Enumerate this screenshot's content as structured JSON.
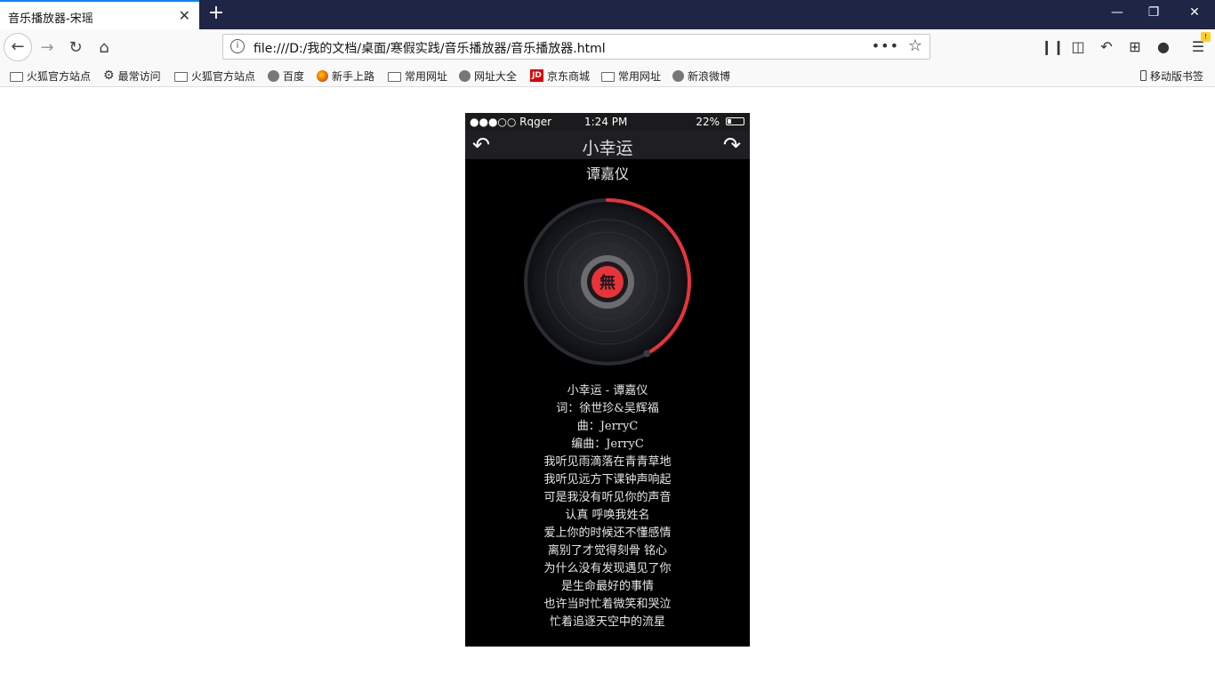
{
  "browser": {
    "tab_title": "音乐播放器-宋瑶",
    "tab_close": "✕",
    "new_tab": "+",
    "url": "file:///D:/我的文档/桌面/寒假实践/音乐播放器/音乐播放器.html",
    "more": "•••",
    "badge": "!"
  },
  "bookmarks": [
    {
      "label": "火狐官方站点",
      "icon": "folder-icon"
    },
    {
      "label": "最常访问",
      "icon": "gear-icon"
    },
    {
      "label": "火狐官方站点",
      "icon": "folder-icon"
    },
    {
      "label": "百度",
      "icon": "globe-icon"
    },
    {
      "label": "新手上路",
      "icon": "firefox-icon"
    },
    {
      "label": "常用网址",
      "icon": "folder-icon"
    },
    {
      "label": "网址大全",
      "icon": "globe-icon"
    },
    {
      "label": "京东商城",
      "icon": "jd-icon"
    },
    {
      "label": "常用网址",
      "icon": "folder-icon"
    },
    {
      "label": "新浪微博",
      "icon": "globe-icon"
    }
  ],
  "mobile_bookmarks": "移动版书签",
  "phone": {
    "carrier": "●●●○○ Rqger",
    "time": "1:24 PM",
    "battery": "22%",
    "battery_level": 0.22,
    "song_title": "小幸运",
    "artist": "谭嘉仪",
    "progress": 0.42,
    "disc_label": "無",
    "accent_color": "#e8333b",
    "lyrics": [
      "小幸运 - 谭嘉仪",
      "词：徐世珍&吴辉福",
      "曲：JerryC",
      "编曲：JerryC",
      "我听见雨滴落在青青草地",
      "我听见远方下课钟声响起",
      "可是我没有听见你的声音",
      "认真 呼唤我姓名",
      "爱上你的时候还不懂感情",
      "离别了才觉得刻骨 铭心",
      "为什么没有发现遇见了你",
      "是生命最好的事情",
      "也许当时忙着微笑和哭泣",
      "忙着追逐天空中的流星"
    ]
  }
}
